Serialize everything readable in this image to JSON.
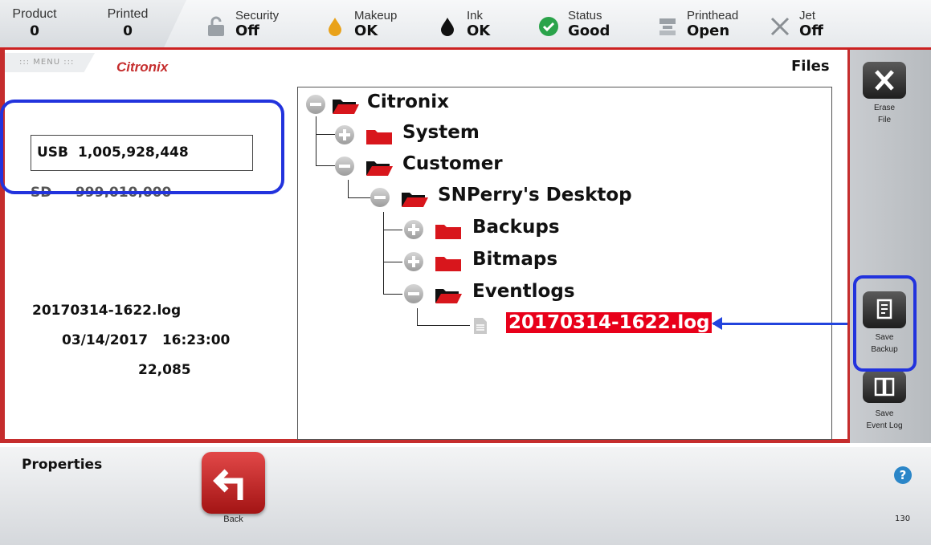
{
  "status_bar": {
    "counters": [
      {
        "label": "Product",
        "value": "0"
      },
      {
        "label": "Printed",
        "value": "0"
      }
    ],
    "items": [
      {
        "icon": "unlock-icon",
        "label": "Security",
        "value": "Off"
      },
      {
        "icon": "makeup-drop-icon",
        "label": "Makeup",
        "value": "OK"
      },
      {
        "icon": "ink-drop-icon",
        "label": "Ink",
        "value": "OK"
      },
      {
        "icon": "check-circle-icon",
        "label": "Status",
        "value": "Good"
      },
      {
        "icon": "printhead-icon",
        "label": "Printhead",
        "value": "Open"
      },
      {
        "icon": "jet-off-icon",
        "label": "Jet",
        "value": "Off"
      }
    ],
    "colors": {
      "accent": "#c52d2d",
      "status_good": "#2aa34a",
      "makeup": "#e9a21a"
    }
  },
  "header": {
    "menu_label": "MENU",
    "brand": "Citronix",
    "title": "Files"
  },
  "storage": {
    "usb_label": "USB",
    "usb_value": "1,005,928,448",
    "sd_label": "SD",
    "sd_value": "999,010,000"
  },
  "file_info": {
    "name": "20170314-1622.log",
    "date": "03/14/2017",
    "time": "16:23:00",
    "size": "22,085"
  },
  "tree": {
    "nodes": [
      {
        "name": "Citronix",
        "state": "expanded"
      },
      {
        "name": "System",
        "state": "collapsed"
      },
      {
        "name": "Customer",
        "state": "expanded"
      },
      {
        "name": "SNPerry's Desktop",
        "state": "expanded"
      },
      {
        "name": "Backups",
        "state": "collapsed"
      },
      {
        "name": "Bitmaps",
        "state": "collapsed"
      },
      {
        "name": "Eventlogs",
        "state": "expanded"
      },
      {
        "name": "20170314-1622.log",
        "state": "selected-file"
      }
    ],
    "selection_color": "#e8001a"
  },
  "sidebar": {
    "erase_line1": "Erase",
    "erase_line2": "File",
    "save_backup_line1": "Save",
    "save_backup_line2": "Backup",
    "save_event_line1": "Save",
    "save_event_line2": "Event Log"
  },
  "footer": {
    "properties": "Properties",
    "back_label": "Back",
    "help": "?",
    "screen_code": "130"
  },
  "annotation_color": "#2233dd"
}
